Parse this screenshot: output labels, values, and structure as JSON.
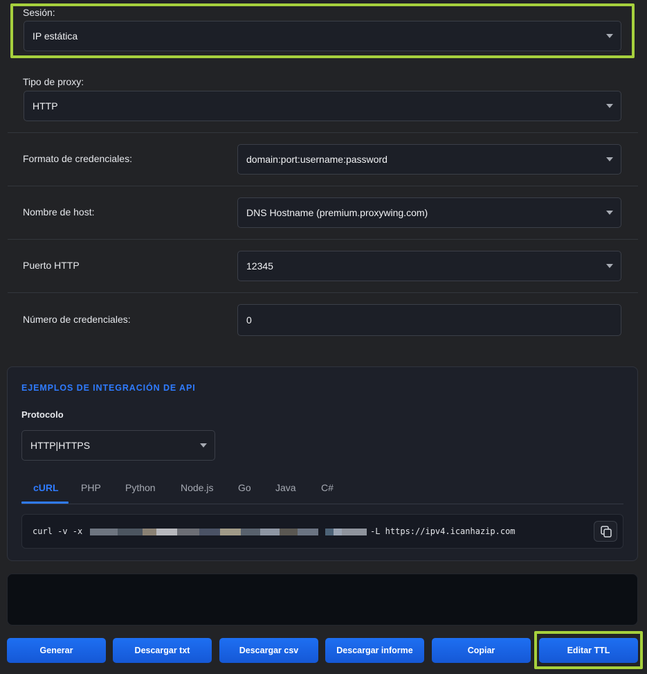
{
  "session": {
    "label": "Sesión:",
    "value": "IP estática"
  },
  "proxy_type": {
    "label": "Tipo de proxy:",
    "value": "HTTP"
  },
  "credential_format": {
    "label": "Formato de credenciales:",
    "value": "domain:port:username:password"
  },
  "hostname": {
    "label": "Nombre de host:",
    "value": "DNS Hostname (premium.proxywing.com)"
  },
  "http_port": {
    "label": "Puerto HTTP",
    "value": "12345"
  },
  "credential_count": {
    "label": "Número de credenciales:",
    "value": "0"
  },
  "api": {
    "title": "EJEMPLOS DE INTEGRACIÓN DE API",
    "protocol_label": "Protocolo",
    "protocol_value": "HTTP|HTTPS",
    "tabs": [
      "cURL",
      "PHP",
      "Python",
      "Node.js",
      "Go",
      "Java",
      "C#"
    ],
    "active_tab": "cURL",
    "code_prefix": "curl -v -x",
    "code_suffix": "-L https://ipv4.icanhazip.com"
  },
  "buttons": {
    "generate": "Generar",
    "download_txt": "Descargar txt",
    "download_csv": "Descargar csv",
    "download_report": "Descargar informe",
    "copy": "Copiar",
    "edit_ttl": "Editar TTL"
  },
  "colors": {
    "accent": "#2f7bff",
    "button": "#1763e6",
    "highlight": "#a6d03d",
    "background": "#222326",
    "field": "#1c1f27"
  }
}
